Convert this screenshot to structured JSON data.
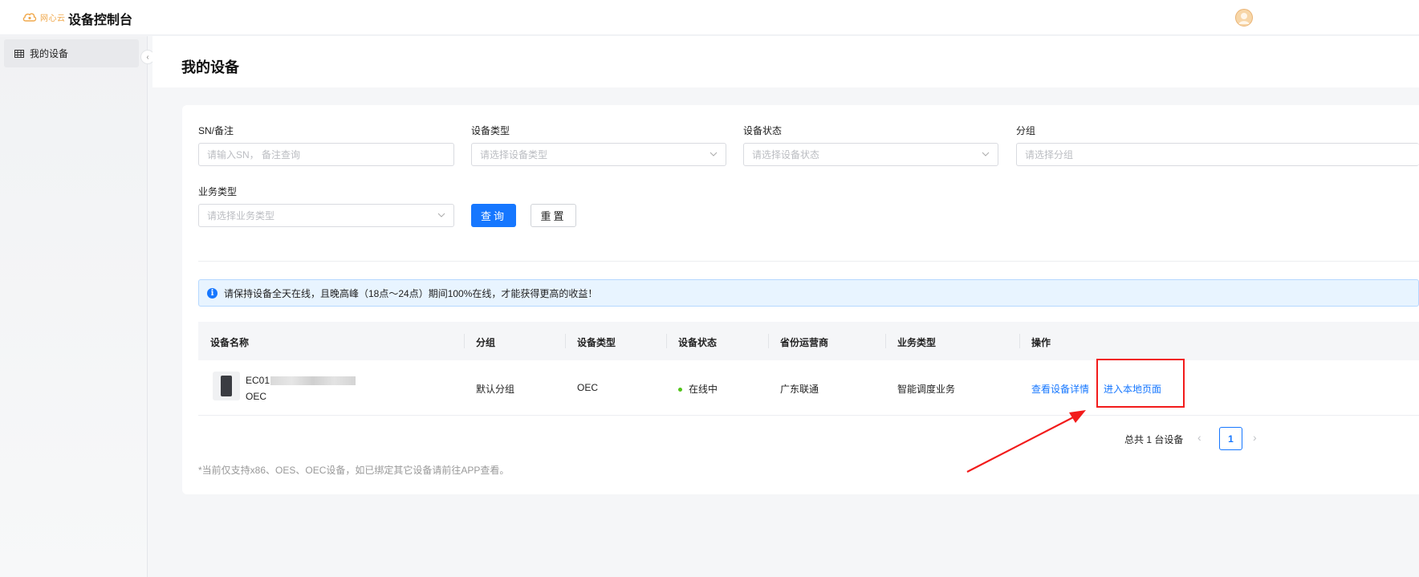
{
  "header": {
    "logo_text": "网心云",
    "app_title": "设备控制台"
  },
  "sidebar": {
    "items": [
      {
        "label": "我的设备",
        "icon": "table-icon"
      }
    ]
  },
  "page": {
    "title": "我的设备"
  },
  "filters": {
    "sn": {
      "label": "SN/备注",
      "placeholder": "请输入SN， 备注查询"
    },
    "device_type": {
      "label": "设备类型",
      "placeholder": "请选择设备类型"
    },
    "device_status": {
      "label": "设备状态",
      "placeholder": "请选择设备状态"
    },
    "group": {
      "label": "分组",
      "placeholder": "请选择分组"
    },
    "business_type": {
      "label": "业务类型",
      "placeholder": "请选择业务类型"
    },
    "query_button": "查询",
    "reset_button": "重置"
  },
  "notice": {
    "text": "请保持设备全天在线，且晚高峰（18点～24点）期间100%在线，才能获得更高的收益！"
  },
  "table": {
    "columns": [
      "设备名称",
      "分组",
      "设备类型",
      "设备状态",
      "省份运营商",
      "业务类型",
      "操作"
    ],
    "rows": [
      {
        "name": "EC01",
        "model": "OEC",
        "group": "默认分组",
        "type": "OEC",
        "status": "在线中",
        "isp": "广东联通",
        "business": "智能调度业务",
        "actions": [
          "查看设备详情",
          "进入本地页面"
        ]
      }
    ]
  },
  "pagination": {
    "total_text": "总共 1 台设备",
    "current_page": "1"
  },
  "footnote": "*当前仅支持x86、OES、OEC设备，如已绑定其它设备请前往APP查看。",
  "colors": {
    "primary": "#1677ff",
    "online": "#52c41a",
    "annotation": "#f21b1b"
  }
}
